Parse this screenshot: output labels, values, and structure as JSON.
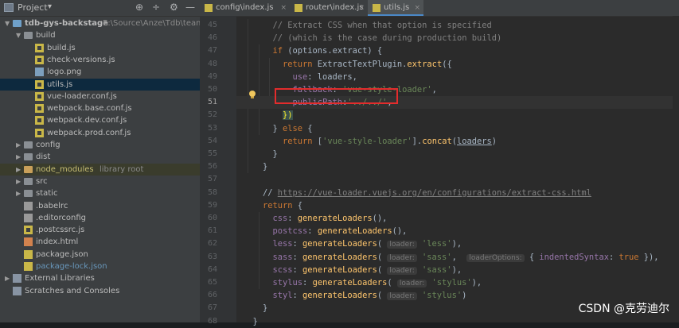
{
  "project_panel": {
    "title": "Project",
    "dropdown": "▾",
    "header_buttons": [
      "⊕",
      "÷",
      "⚙",
      "—"
    ],
    "rows": [
      {
        "name": "tree-root",
        "label": "tdb-gys-backstage",
        "suffix": "E:\\Source\\Anze\\Tdb\\team16",
        "depth": 0,
        "arrow": "▼",
        "icon": "folder-blue",
        "bold": true
      },
      {
        "name": "tree-build",
        "label": "build",
        "depth": 1,
        "arrow": "▼",
        "icon": "folder"
      },
      {
        "name": "tree-build-js",
        "label": "build.js",
        "depth": 2,
        "icon": "js"
      },
      {
        "name": "tree-check-versions",
        "label": "check-versions.js",
        "depth": 2,
        "icon": "js"
      },
      {
        "name": "tree-logo",
        "label": "logo.png",
        "depth": 2,
        "icon": "img"
      },
      {
        "name": "tree-utils",
        "label": "utils.js",
        "depth": 2,
        "icon": "js",
        "selected": true
      },
      {
        "name": "tree-vue-loader-conf",
        "label": "vue-loader.conf.js",
        "depth": 2,
        "icon": "js"
      },
      {
        "name": "tree-webpack-base",
        "label": "webpack.base.conf.js",
        "depth": 2,
        "icon": "js"
      },
      {
        "name": "tree-webpack-dev",
        "label": "webpack.dev.conf.js",
        "depth": 2,
        "icon": "js"
      },
      {
        "name": "tree-webpack-prod",
        "label": "webpack.prod.conf.js",
        "depth": 2,
        "icon": "js"
      },
      {
        "name": "tree-config",
        "label": "config",
        "depth": 1,
        "arrow": "▶",
        "icon": "folder"
      },
      {
        "name": "tree-dist",
        "label": "dist",
        "depth": 1,
        "arrow": "▶",
        "icon": "folder"
      },
      {
        "name": "tree-node-modules",
        "label": "node_modules",
        "suffix": "library root",
        "depth": 1,
        "arrow": "▶",
        "icon": "folder-orange",
        "excluded": true
      },
      {
        "name": "tree-src",
        "label": "src",
        "depth": 1,
        "arrow": "▶",
        "icon": "folder"
      },
      {
        "name": "tree-static",
        "label": "static",
        "depth": 1,
        "arrow": "▶",
        "icon": "folder"
      },
      {
        "name": "tree-babelrc",
        "label": ".babelrc",
        "depth": 1,
        "icon": "cfg"
      },
      {
        "name": "tree-editorconfig",
        "label": ".editorconfig",
        "depth": 1,
        "icon": "cfg"
      },
      {
        "name": "tree-postcssrc",
        "label": ".postcssrc.js",
        "depth": 1,
        "icon": "js"
      },
      {
        "name": "tree-index-html",
        "label": "index.html",
        "depth": 1,
        "icon": "html"
      },
      {
        "name": "tree-package-json",
        "label": "package.json",
        "depth": 1,
        "icon": "json"
      },
      {
        "name": "tree-package-lock",
        "label": "package-lock.json",
        "depth": 1,
        "icon": "json",
        "blue": true
      },
      {
        "name": "tree-external-libraries",
        "label": "External Libraries",
        "depth": 0,
        "arrow": "▶",
        "icon": "lib"
      },
      {
        "name": "tree-scratches",
        "label": "Scratches and Consoles",
        "depth": 0,
        "icon": "lib"
      }
    ]
  },
  "tabs": [
    {
      "label": "config\\index.js",
      "active": false
    },
    {
      "label": "router\\index.js",
      "active": false
    },
    {
      "label": "utils.js",
      "active": true
    }
  ],
  "tab_close": "×",
  "editor": {
    "current_line": 51,
    "lines": [
      {
        "n": 45,
        "indent": 3,
        "tokens": [
          {
            "t": "// Extract CSS when that option is specified",
            "c": "cm"
          }
        ]
      },
      {
        "n": 46,
        "indent": 3,
        "tokens": [
          {
            "t": "// (which is the case during production build)",
            "c": "cm"
          }
        ]
      },
      {
        "n": 47,
        "indent": 3,
        "tokens": [
          {
            "t": "if",
            "c": "kw"
          },
          {
            "t": " (options.extract) {"
          }
        ]
      },
      {
        "n": 48,
        "indent": 4,
        "tokens": [
          {
            "t": "return ",
            "c": "kw"
          },
          {
            "t": "ExtractTextPlugin.",
            "c": ""
          },
          {
            "t": "extract",
            "c": "fn"
          },
          {
            "t": "({"
          }
        ]
      },
      {
        "n": 49,
        "indent": 5,
        "tokens": [
          {
            "t": "use",
            "c": "prop"
          },
          {
            "t": ": loaders,"
          }
        ]
      },
      {
        "n": 50,
        "indent": 5,
        "tokens": [
          {
            "t": "fallback",
            "c": "prop"
          },
          {
            "t": ": "
          },
          {
            "t": "'vue-style-loader'",
            "c": "str"
          },
          {
            "t": ","
          }
        ]
      },
      {
        "n": 51,
        "indent": 5,
        "tokens": [
          {
            "t": "publicPath",
            "c": "prop"
          },
          {
            "t": ":"
          },
          {
            "t": "'../../'",
            "c": "str"
          },
          {
            "t": ","
          }
        ]
      },
      {
        "n": 52,
        "indent": 4,
        "tokens": [
          {
            "t": "})",
            "c": "phl"
          }
        ]
      },
      {
        "n": 53,
        "indent": 3,
        "tokens": [
          {
            "t": "} "
          },
          {
            "t": "else",
            "c": "kw"
          },
          {
            "t": " {"
          }
        ]
      },
      {
        "n": 54,
        "indent": 4,
        "tokens": [
          {
            "t": "return ",
            "c": "kw"
          },
          {
            "t": "["
          },
          {
            "t": "'vue-style-loader'",
            "c": "str"
          },
          {
            "t": "]."
          },
          {
            "t": "concat",
            "c": "fn"
          },
          {
            "t": "("
          },
          {
            "t": "loaders",
            "c": "u"
          },
          {
            "t": ")"
          }
        ]
      },
      {
        "n": 55,
        "indent": 3,
        "tokens": [
          {
            "t": "}"
          }
        ]
      },
      {
        "n": 56,
        "indent": 2,
        "tokens": [
          {
            "t": "}"
          }
        ]
      },
      {
        "n": 57,
        "indent": 0,
        "tokens": []
      },
      {
        "n": 58,
        "indent": 2,
        "tokens": [
          {
            "t": "// "
          },
          {
            "t": "https://vue-loader.vuejs.org/en/configurations/extract-css.html",
            "c": "link"
          }
        ]
      },
      {
        "n": 59,
        "indent": 2,
        "tokens": [
          {
            "t": "return",
            "c": "kw"
          },
          {
            "t": " {"
          }
        ]
      },
      {
        "n": 60,
        "indent": 3,
        "tokens": [
          {
            "t": "css",
            "c": "prop"
          },
          {
            "t": ": "
          },
          {
            "t": "generateLoaders",
            "c": "fn"
          },
          {
            "t": "(),"
          }
        ]
      },
      {
        "n": 61,
        "indent": 3,
        "tokens": [
          {
            "t": "postcss",
            "c": "prop"
          },
          {
            "t": ": "
          },
          {
            "t": "generateLoaders",
            "c": "fn"
          },
          {
            "t": "(),"
          }
        ]
      },
      {
        "n": 62,
        "indent": 3,
        "tokens": [
          {
            "t": "less",
            "c": "prop"
          },
          {
            "t": ": "
          },
          {
            "t": "generateLoaders",
            "c": "fn"
          },
          {
            "t": "( "
          },
          {
            "t": "loader:",
            "c": "hint"
          },
          {
            "t": " "
          },
          {
            "t": "'less'",
            "c": "str"
          },
          {
            "t": "),"
          }
        ]
      },
      {
        "n": 63,
        "indent": 3,
        "tokens": [
          {
            "t": "sass",
            "c": "prop"
          },
          {
            "t": ": "
          },
          {
            "t": "generateLoaders",
            "c": "fn"
          },
          {
            "t": "( "
          },
          {
            "t": "loader:",
            "c": "hint"
          },
          {
            "t": " "
          },
          {
            "t": "'sass'",
            "c": "str"
          },
          {
            "t": ",  "
          },
          {
            "t": "loaderOptions:",
            "c": "hint"
          },
          {
            "t": " { "
          },
          {
            "t": "indentedSyntax",
            "c": "prop"
          },
          {
            "t": ": "
          },
          {
            "t": "true",
            "c": "kw"
          },
          {
            "t": " }),"
          }
        ]
      },
      {
        "n": 64,
        "indent": 3,
        "tokens": [
          {
            "t": "scss",
            "c": "prop"
          },
          {
            "t": ": "
          },
          {
            "t": "generateLoaders",
            "c": "fn"
          },
          {
            "t": "( "
          },
          {
            "t": "loader:",
            "c": "hint"
          },
          {
            "t": " "
          },
          {
            "t": "'sass'",
            "c": "str"
          },
          {
            "t": "),"
          }
        ]
      },
      {
        "n": 65,
        "indent": 3,
        "tokens": [
          {
            "t": "stylus",
            "c": "prop"
          },
          {
            "t": ": "
          },
          {
            "t": "generateLoaders",
            "c": "fn"
          },
          {
            "t": "( "
          },
          {
            "t": "loader:",
            "c": "hint"
          },
          {
            "t": " "
          },
          {
            "t": "'stylus'",
            "c": "str"
          },
          {
            "t": "),"
          }
        ]
      },
      {
        "n": 66,
        "indent": 3,
        "tokens": [
          {
            "t": "styl",
            "c": "prop"
          },
          {
            "t": ": "
          },
          {
            "t": "generateLoaders",
            "c": "fn"
          },
          {
            "t": "( "
          },
          {
            "t": "loader:",
            "c": "hint"
          },
          {
            "t": " "
          },
          {
            "t": "'stylus'",
            "c": "str"
          },
          {
            "t": ")"
          }
        ]
      },
      {
        "n": 67,
        "indent": 2,
        "tokens": [
          {
            "t": "}"
          }
        ]
      },
      {
        "n": 68,
        "indent": 1,
        "tokens": [
          {
            "t": "}"
          }
        ]
      }
    ]
  },
  "watermark": "CSDN @克劳迪尔",
  "colors": {
    "highlight_box": "#e32c2c",
    "selection": "#0d293e",
    "accent_tab": "#4a88c7"
  }
}
